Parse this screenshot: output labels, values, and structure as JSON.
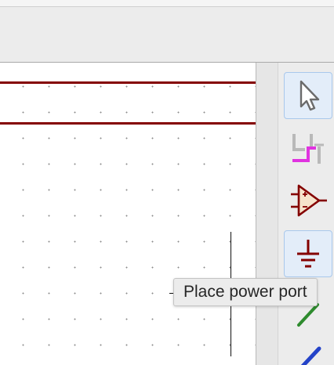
{
  "tooltip": {
    "text": "Place power port"
  },
  "right_toolbar": {
    "tools": [
      {
        "name": "select",
        "icon": "arrow-cursor-icon",
        "active": true
      },
      {
        "name": "place-no-connect",
        "icon": "wire-to-bus-entry-icon",
        "active": false
      },
      {
        "name": "place-symbol",
        "icon": "opamp-symbol-icon",
        "active": false
      },
      {
        "name": "place-power",
        "icon": "ground-power-port-icon",
        "active": true
      },
      {
        "name": "place-wire",
        "icon": "green-wire-icon",
        "active": false
      },
      {
        "name": "place-bus",
        "icon": "blue-bus-icon",
        "active": false
      }
    ]
  },
  "colors": {
    "wire": "#840000",
    "symbol": "#840000",
    "bus_entry": "#e033e0",
    "wire_tool": "#2e8b2e",
    "bus_tool": "#2443c8",
    "active_tool_bg": "#e3edf9"
  }
}
